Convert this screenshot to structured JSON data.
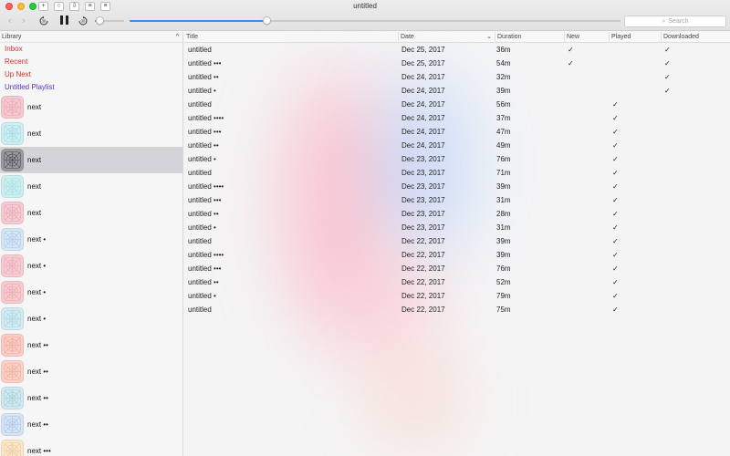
{
  "window": {
    "title": "untitled"
  },
  "toolbar": {
    "skip_back_label": "30",
    "skip_forward_label": "30",
    "volume_fraction": 0.16,
    "progress_fraction": 0.28,
    "search_placeholder": "Search"
  },
  "sidebar": {
    "header": "Library",
    "links": [
      {
        "label": "Inbox",
        "color": "#d0312d"
      },
      {
        "label": "Recent",
        "color": "#d0312d"
      },
      {
        "label": "Up Next",
        "color": "#d0312d"
      },
      {
        "label": "Untitled Playlist",
        "color": "#5a34c8"
      }
    ],
    "items": [
      {
        "label": "next",
        "tint": "#f6c9d1",
        "line": "#e7a3b0"
      },
      {
        "label": "next",
        "tint": "#cdeff3",
        "line": "#9fd6df"
      },
      {
        "label": "next",
        "tint": "#9a9a9f",
        "line": "#444449",
        "selected": true
      },
      {
        "label": "next",
        "tint": "#cdeff1",
        "line": "#a4dbe0"
      },
      {
        "label": "next",
        "tint": "#f6cbd4",
        "line": "#e6a2b0"
      },
      {
        "label": "next •",
        "tint": "#d6e6f6",
        "line": "#a9c7e6"
      },
      {
        "label": "next •",
        "tint": "#f7ccd3",
        "line": "#e8a7b3"
      },
      {
        "label": "next •",
        "tint": "#f8cbd1",
        "line": "#e9a3ad"
      },
      {
        "label": "next •",
        "tint": "#d3ebf2",
        "line": "#a5d2e0"
      },
      {
        "label": "next ••",
        "tint": "#fbcdc6",
        "line": "#efa698"
      },
      {
        "label": "next ••",
        "tint": "#fbd2c8",
        "line": "#eea792"
      },
      {
        "label": "next ••",
        "tint": "#d1e9ef",
        "line": "#9fcbd8"
      },
      {
        "label": "next ••",
        "tint": "#d6e4f6",
        "line": "#a7c1e7"
      },
      {
        "label": "next •••",
        "tint": "#fbe7cb",
        "line": "#ecc591"
      }
    ]
  },
  "table": {
    "columns": [
      "Title",
      "Date",
      "Duration",
      "New",
      "Played",
      "Downloaded"
    ],
    "rows": [
      {
        "title": "untitled",
        "date": "Dec 25, 2017",
        "duration": "36m",
        "new": true,
        "played": false,
        "downloaded": true
      },
      {
        "title": "untitled •••",
        "date": "Dec 25, 2017",
        "duration": "54m",
        "new": true,
        "played": false,
        "downloaded": true
      },
      {
        "title": "untitled ••",
        "date": "Dec 24, 2017",
        "duration": "32m",
        "new": false,
        "played": false,
        "downloaded": true
      },
      {
        "title": "untitled •",
        "date": "Dec 24, 2017",
        "duration": "39m",
        "new": false,
        "played": false,
        "downloaded": true
      },
      {
        "title": "untitled",
        "date": "Dec 24, 2017",
        "duration": "56m",
        "new": false,
        "played": true,
        "downloaded": false
      },
      {
        "title": "untitled ••••",
        "date": "Dec 24, 2017",
        "duration": "37m",
        "new": false,
        "played": true,
        "downloaded": false
      },
      {
        "title": "untitled •••",
        "date": "Dec 24, 2017",
        "duration": "47m",
        "new": false,
        "played": true,
        "downloaded": false
      },
      {
        "title": "untitled ••",
        "date": "Dec 24, 2017",
        "duration": "49m",
        "new": false,
        "played": true,
        "downloaded": false
      },
      {
        "title": "untitled •",
        "date": "Dec 23, 2017",
        "duration": "76m",
        "new": false,
        "played": true,
        "downloaded": false
      },
      {
        "title": "untitled",
        "date": "Dec 23, 2017",
        "duration": "71m",
        "new": false,
        "played": true,
        "downloaded": false
      },
      {
        "title": "untitled ••••",
        "date": "Dec 23, 2017",
        "duration": "39m",
        "new": false,
        "played": true,
        "downloaded": false
      },
      {
        "title": "untitled •••",
        "date": "Dec 23, 2017",
        "duration": "31m",
        "new": false,
        "played": true,
        "downloaded": false
      },
      {
        "title": "untitled ••",
        "date": "Dec 23, 2017",
        "duration": "28m",
        "new": false,
        "played": true,
        "downloaded": false
      },
      {
        "title": "untitled •",
        "date": "Dec 23, 2017",
        "duration": "31m",
        "new": false,
        "played": true,
        "downloaded": false
      },
      {
        "title": "untitled",
        "date": "Dec 22, 2017",
        "duration": "39m",
        "new": false,
        "played": true,
        "downloaded": false
      },
      {
        "title": "untitled ••••",
        "date": "Dec 22, 2017",
        "duration": "39m",
        "new": false,
        "played": true,
        "downloaded": false
      },
      {
        "title": "untitled •••",
        "date": "Dec 22, 2017",
        "duration": "76m",
        "new": false,
        "played": true,
        "downloaded": false
      },
      {
        "title": "untitled ••",
        "date": "Dec 22, 2017",
        "duration": "52m",
        "new": false,
        "played": true,
        "downloaded": false
      },
      {
        "title": "untitled •",
        "date": "Dec 22, 2017",
        "duration": "79m",
        "new": false,
        "played": true,
        "downloaded": false
      },
      {
        "title": "untitled",
        "date": "Dec 22, 2017",
        "duration": "75m",
        "new": false,
        "played": true,
        "downloaded": false
      }
    ]
  },
  "colors": {
    "accent": "#3a8ee6",
    "check": "#1f1f1f"
  }
}
